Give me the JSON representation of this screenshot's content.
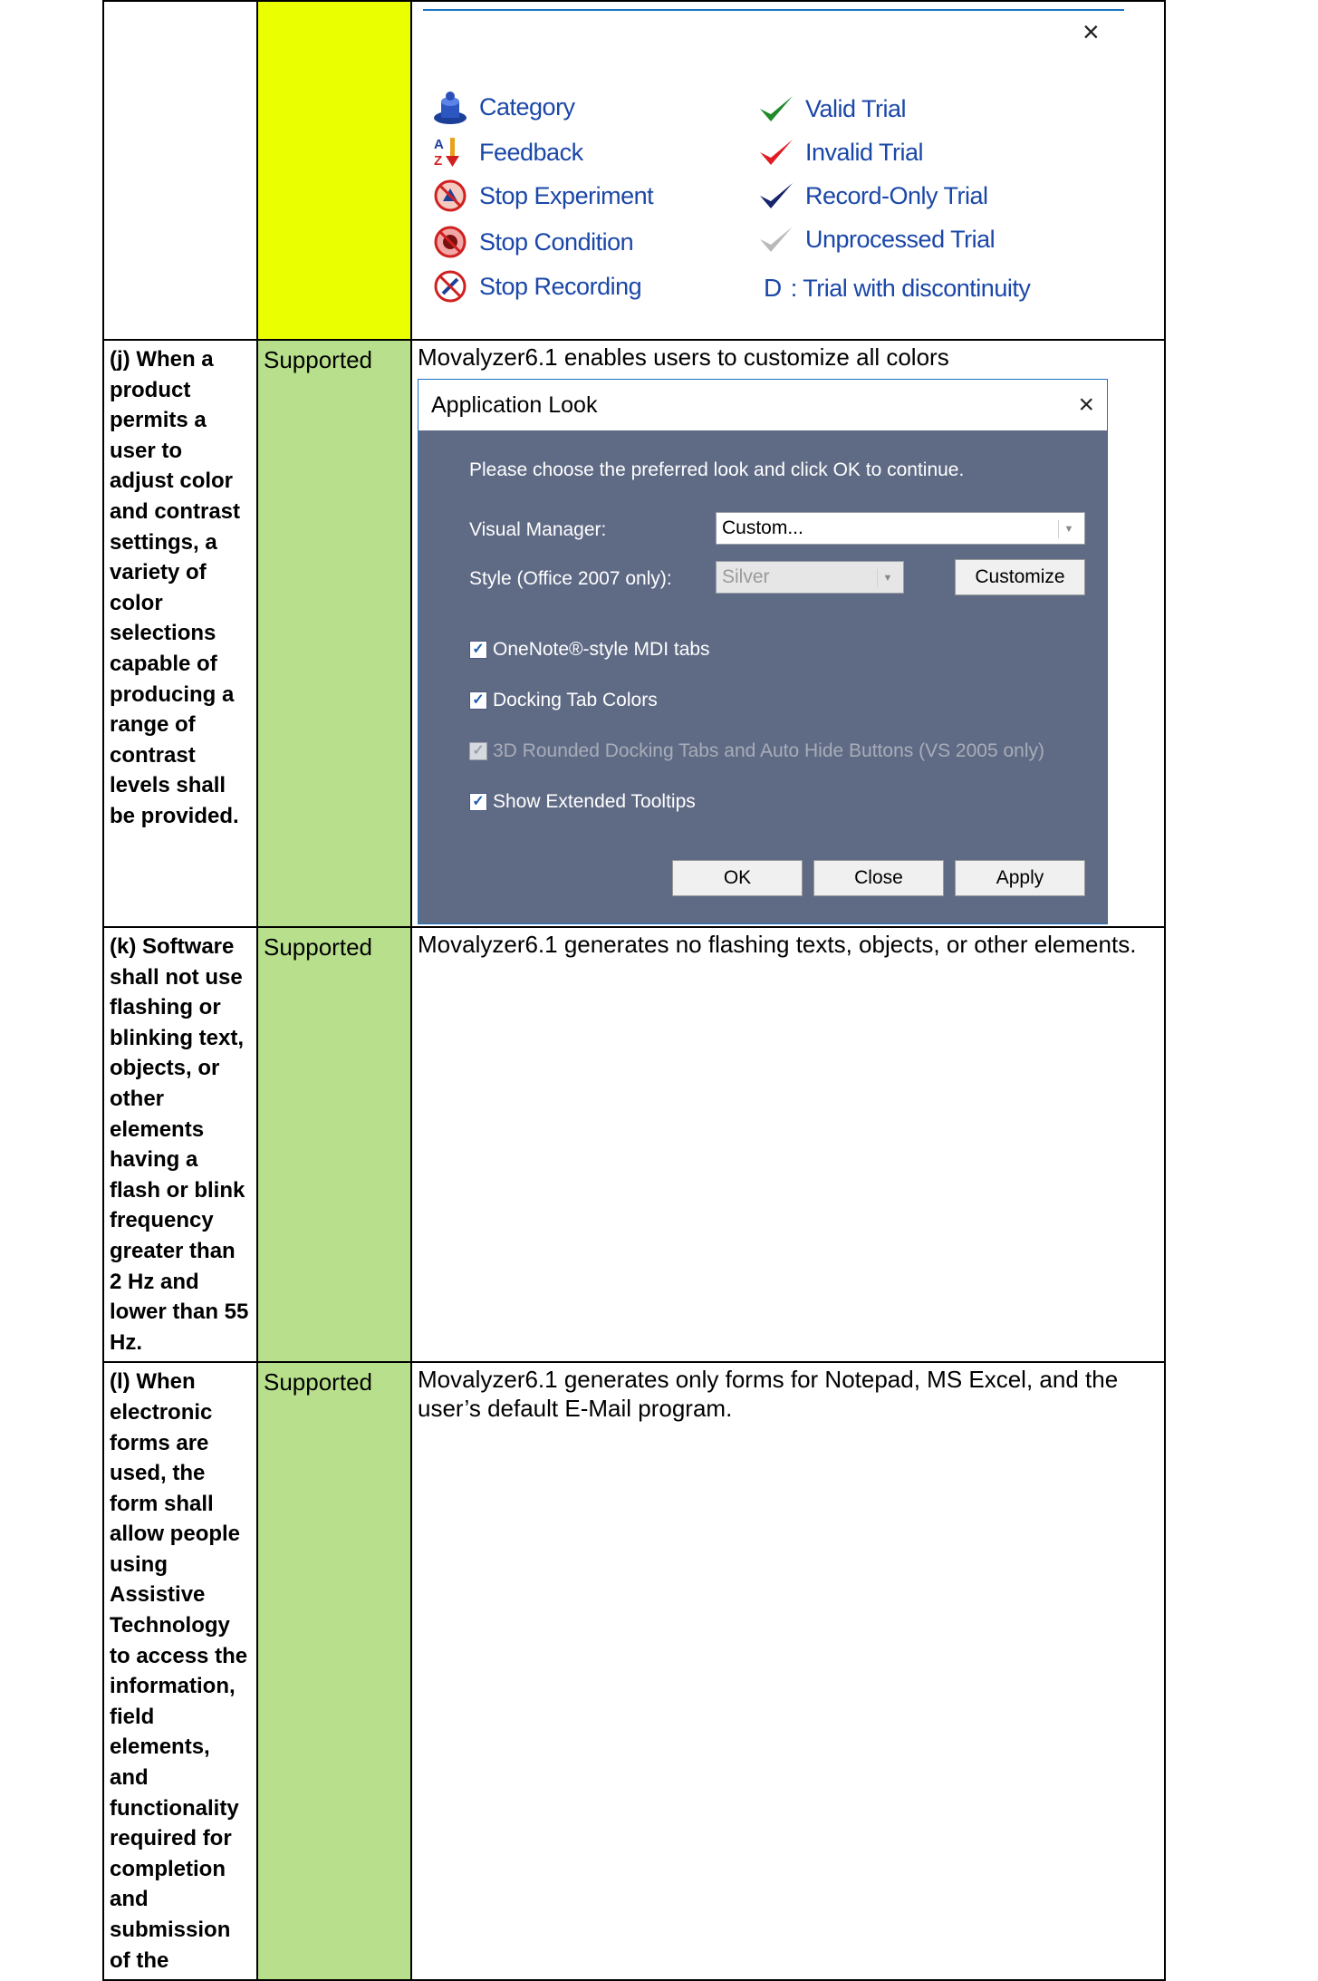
{
  "legend": {
    "close_glyph": "×",
    "left_items": [
      {
        "label": "Category",
        "icon": "category-icon"
      },
      {
        "label": "Feedback",
        "icon": "feedback-az-icon"
      },
      {
        "label": "Stop Experiment",
        "icon": "stop-experiment-icon"
      },
      {
        "label": "Stop Condition",
        "icon": "stop-condition-icon"
      },
      {
        "label": "Stop Recording",
        "icon": "stop-recording-icon"
      }
    ],
    "right_items": [
      {
        "label": "Valid Trial",
        "icon": "green-check-icon",
        "color": "#1f8a2a"
      },
      {
        "label": "Invalid Trial",
        "icon": "red-check-icon",
        "color": "#e01b24"
      },
      {
        "label": "Record-Only Trial",
        "icon": "navy-check-icon",
        "color": "#17236b"
      },
      {
        "label": "Unprocessed Trial",
        "icon": "gray-check-icon",
        "color": "#b9b9b9"
      }
    ],
    "discontinuity": {
      "letter": "D",
      "label": ": Trial with discontinuity"
    }
  },
  "rows": [
    {
      "criterion": "(j) When a product permits a user to adjust color and contrast settings, a variety of color selections capable of producing a range of contrast levels shall be provided.",
      "status": "Supported",
      "remarks": "Movalyzer6.1 enables users to customize all colors"
    },
    {
      "criterion": "(k) Software shall not use flashing or blinking text, objects, or other elements having a flash or blink frequency greater than 2 Hz and lower than 55 Hz.",
      "status": "Supported",
      "remarks": "Movalyzer6.1 generates no flashing texts, objects, or other elements."
    },
    {
      "criterion": "(l) When electronic forms are used, the form shall allow people using Assistive Technology to access the information, field elements, and functionality required for completion and submission of the",
      "status": "Supported",
      "remarks": "Movalyzer6.1 generates only forms for Notepad, MS Excel, and the user’s default E-Mail program."
    }
  ],
  "dialog": {
    "title": "Application Look",
    "close_glyph": "×",
    "prompt": "Please choose the preferred look and click OK to continue.",
    "visual_manager_label": "Visual Manager:",
    "visual_manager_value": "Custom...",
    "style_label": "Style (Office 2007 only):",
    "style_value": "Silver",
    "customize_button": "Customize",
    "checkboxes": [
      {
        "label": "OneNote®-style MDI tabs",
        "checked": true,
        "enabled": true
      },
      {
        "label": "Docking Tab Colors",
        "checked": true,
        "enabled": true
      },
      {
        "label": "3D Rounded Docking Tabs and Auto Hide Buttons (VS 2005 only)",
        "checked": true,
        "enabled": false
      },
      {
        "label": "Show Extended Tooltips",
        "checked": true,
        "enabled": true
      }
    ],
    "ok_button": "OK",
    "close_button": "Close",
    "apply_button": "Apply",
    "client_color": "#5f6a85"
  },
  "colors": {
    "status_green": "#b8e08c",
    "status_yellow": "#eaff00",
    "legend_text": "#1a47a8"
  }
}
